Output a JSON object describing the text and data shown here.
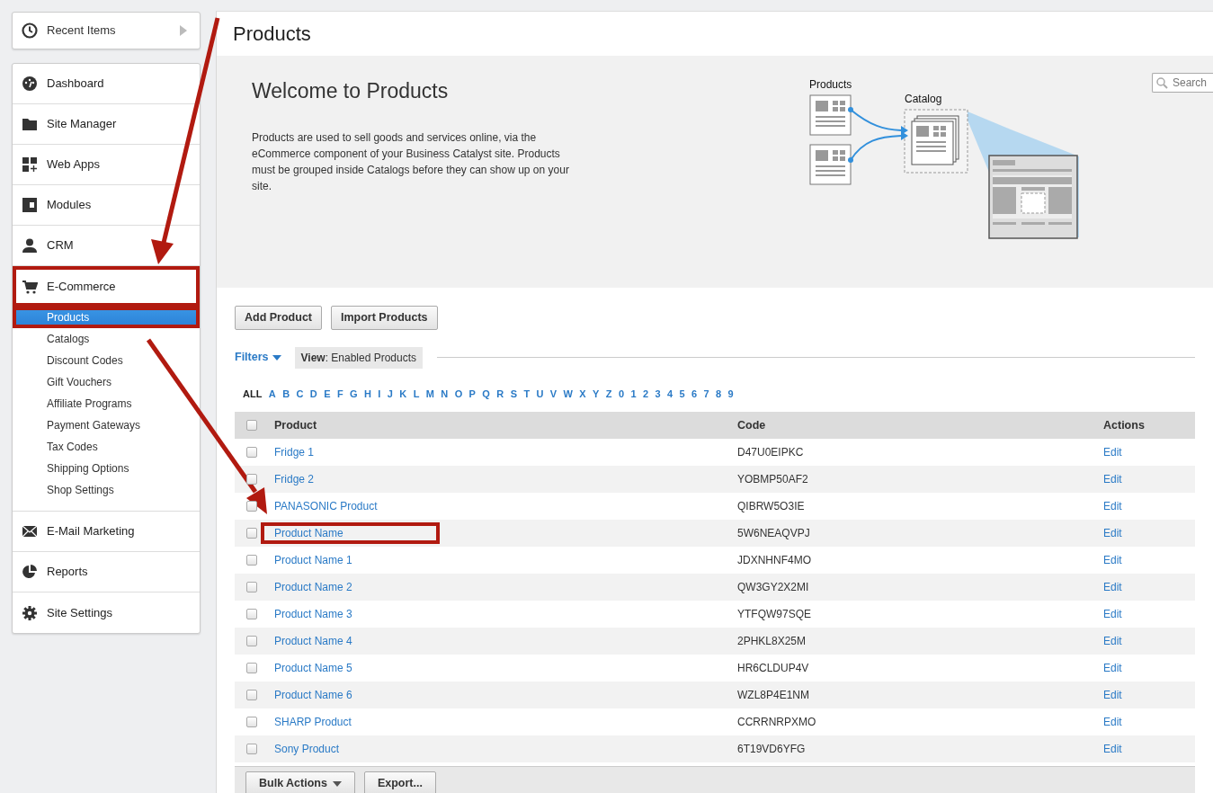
{
  "recent": {
    "label": "Recent Items"
  },
  "nav": [
    {
      "label": "Dashboard",
      "highlighted": false
    },
    {
      "label": "Site Manager",
      "highlighted": false
    },
    {
      "label": "Web Apps",
      "highlighted": false
    },
    {
      "label": "Modules",
      "highlighted": false
    },
    {
      "label": "CRM",
      "highlighted": false
    },
    {
      "label": "E-Commerce",
      "highlighted": true,
      "children": [
        {
          "label": "Products",
          "selected": true,
          "highlighted": true
        },
        {
          "label": "Catalogs",
          "selected": false,
          "highlighted": false
        },
        {
          "label": "Discount Codes",
          "selected": false,
          "highlighted": false
        },
        {
          "label": "Gift Vouchers",
          "selected": false,
          "highlighted": false
        },
        {
          "label": "Affiliate Programs",
          "selected": false,
          "highlighted": false
        },
        {
          "label": "Payment Gateways",
          "selected": false,
          "highlighted": false
        },
        {
          "label": "Tax Codes",
          "selected": false,
          "highlighted": false
        },
        {
          "label": "Shipping Options",
          "selected": false,
          "highlighted": false
        },
        {
          "label": "Shop Settings",
          "selected": false,
          "highlighted": false
        }
      ]
    },
    {
      "label": "E-Mail Marketing",
      "highlighted": false
    },
    {
      "label": "Reports",
      "highlighted": false
    },
    {
      "label": "Site Settings",
      "highlighted": false
    }
  ],
  "page_title": "Products",
  "hero": {
    "title": "Welcome to Products",
    "text": "Products are used to sell goods and services online, via the eCommerce component of your Business Catalyst site. Products must be grouped inside Catalogs before they can show up on your site.",
    "diagram_labels": [
      "Products",
      "Catalog"
    ]
  },
  "search": {
    "placeholder": "Search"
  },
  "buttons": [
    "Add Product",
    "Import Products"
  ],
  "filters": {
    "label": "Filters",
    "view": "**View**: Enabled Products"
  },
  "letters": [
    {
      "label": "ALL",
      "selected": true
    },
    {
      "label": "A",
      "selected": false
    },
    {
      "label": "B",
      "selected": false
    },
    {
      "label": "C",
      "selected": false
    },
    {
      "label": "D",
      "selected": false
    },
    {
      "label": "E",
      "selected": false
    },
    {
      "label": "F",
      "selected": false
    },
    {
      "label": "G",
      "selected": false
    },
    {
      "label": "H",
      "selected": false
    },
    {
      "label": "I",
      "selected": false
    },
    {
      "label": "J",
      "selected": false
    },
    {
      "label": "K",
      "selected": false
    },
    {
      "label": "L",
      "selected": false
    },
    {
      "label": "M",
      "selected": false
    },
    {
      "label": "N",
      "selected": false
    },
    {
      "label": "O",
      "selected": false
    },
    {
      "label": "P",
      "selected": false
    },
    {
      "label": "Q",
      "selected": false
    },
    {
      "label": "R",
      "selected": false
    },
    {
      "label": "S",
      "selected": false
    },
    {
      "label": "T",
      "selected": false
    },
    {
      "label": "U",
      "selected": false
    },
    {
      "label": "V",
      "selected": false
    },
    {
      "label": "W",
      "selected": false
    },
    {
      "label": "X",
      "selected": false
    },
    {
      "label": "Y",
      "selected": false
    },
    {
      "label": "Z",
      "selected": false
    },
    {
      "label": "0",
      "selected": false
    },
    {
      "label": "1",
      "selected": false
    },
    {
      "label": "2",
      "selected": false
    },
    {
      "label": "3",
      "selected": false
    },
    {
      "label": "4",
      "selected": false
    },
    {
      "label": "5",
      "selected": false
    },
    {
      "label": "6",
      "selected": false
    },
    {
      "label": "7",
      "selected": false
    },
    {
      "label": "8",
      "selected": false
    },
    {
      "label": "9",
      "selected": false
    }
  ],
  "table": {
    "columns": [
      "Product",
      "Code",
      "Actions"
    ],
    "all_checked": false,
    "rows": [
      {
        "product": "Fridge 1",
        "code": "D47U0EIPKC",
        "action": "Edit",
        "checked": false,
        "highlighted": false
      },
      {
        "product": "Fridge 2",
        "code": "YOBMP50AF2",
        "action": "Edit",
        "checked": false,
        "highlighted": false
      },
      {
        "product": "PANASONIC Product",
        "code": "QIBRW5O3IE",
        "action": "Edit",
        "checked": false,
        "highlighted": false
      },
      {
        "product": "Product Name",
        "code": "5W6NEAQVPJ",
        "action": "Edit",
        "checked": false,
        "highlighted": true
      },
      {
        "product": "Product Name 1",
        "code": "JDXNHNF4MO",
        "action": "Edit",
        "checked": false,
        "highlighted": false
      },
      {
        "product": "Product Name 2",
        "code": "QW3GY2X2MI",
        "action": "Edit",
        "checked": false,
        "highlighted": false
      },
      {
        "product": "Product Name 3",
        "code": "YTFQW97SQE",
        "action": "Edit",
        "checked": false,
        "highlighted": false
      },
      {
        "product": "Product Name 4",
        "code": "2PHKL8X25M",
        "action": "Edit",
        "checked": false,
        "highlighted": false
      },
      {
        "product": "Product Name 5",
        "code": "HR6CLDUP4V",
        "action": "Edit",
        "checked": false,
        "highlighted": false
      },
      {
        "product": "Product Name 6",
        "code": "WZL8P4E1NM",
        "action": "Edit",
        "checked": false,
        "highlighted": false
      },
      {
        "product": "SHARP Product",
        "code": "CCRRNRPXMO",
        "action": "Edit",
        "checked": false,
        "highlighted": false
      },
      {
        "product": "Sony Product",
        "code": "6T19VD6YFG",
        "action": "Edit",
        "checked": false,
        "highlighted": false
      }
    ]
  },
  "footer_buttons": [
    {
      "label": "Bulk Actions",
      "kind": "dropdown"
    },
    {
      "label": "Export...",
      "kind": "plain"
    }
  ]
}
